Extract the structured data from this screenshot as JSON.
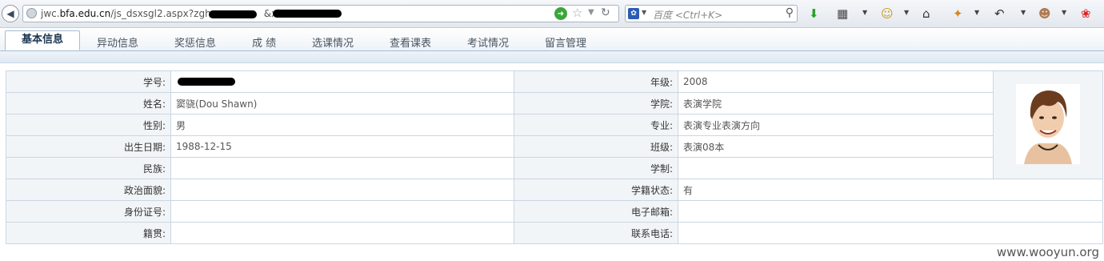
{
  "browser": {
    "url_prefix": "jwc.",
    "url_domain": "bfa.edu.cn",
    "url_path": "/js_dsxsgl2.aspx?zgh=",
    "url_mid": "&xh=",
    "search_placeholder": "百度 <Ctrl+K>"
  },
  "tabs": [
    {
      "label": "基本信息",
      "active": true
    },
    {
      "label": "异动信息"
    },
    {
      "label": "奖惩信息"
    },
    {
      "label": "成 绩"
    },
    {
      "label": "选课情况"
    },
    {
      "label": "查看课表"
    },
    {
      "label": "考试情况"
    },
    {
      "label": "留言管理"
    }
  ],
  "student": {
    "rows": [
      {
        "l1": "学号:",
        "v1": "",
        "l2": "年级:",
        "v2": "2008"
      },
      {
        "l1": "姓名:",
        "v1": "窦骁(Dou Shawn)",
        "l2": "学院:",
        "v2": "表演学院"
      },
      {
        "l1": "性别:",
        "v1": "男",
        "l2": "专业:",
        "v2": "表演专业表演方向"
      },
      {
        "l1": "出生日期:",
        "v1": "1988-12-15",
        "l2": "班级:",
        "v2": "表演08本"
      },
      {
        "l1": "民族:",
        "v1": "",
        "l2": "学制:",
        "v2": ""
      },
      {
        "l1": "政治面貌:",
        "v1": "",
        "l2": "学籍状态:",
        "v2": "有"
      },
      {
        "l1": "身份证号:",
        "v1": "",
        "l2": "电子邮箱:",
        "v2": ""
      },
      {
        "l1": "籍贯:",
        "v1": "",
        "l2": "联系电话:",
        "v2": ""
      }
    ]
  },
  "watermark": "www.wooyun.org"
}
